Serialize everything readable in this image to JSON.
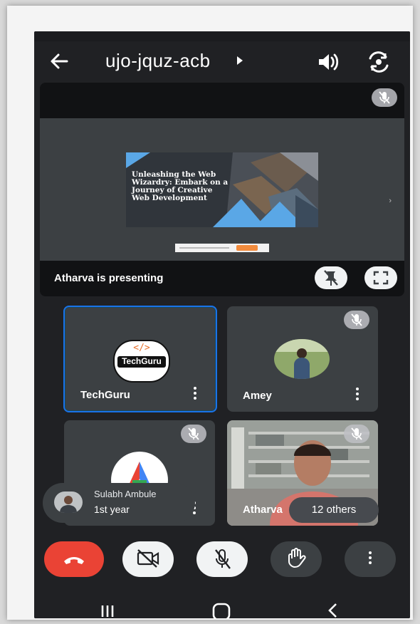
{
  "meeting": {
    "code": "ujo-jquz-acb"
  },
  "presentation": {
    "presenter_label": "Atharva is presenting",
    "slide_title": "Unleashing the Web Wizardry: Embark on a Journey of Creative Web Development"
  },
  "tiles": [
    {
      "name": "TechGuru",
      "logo_text": "TechGuru"
    },
    {
      "name": "Amey"
    },
    {
      "name": ""
    },
    {
      "name": "Atharva"
    }
  ],
  "self_view": {
    "name": "Sulabh Ambule",
    "subtitle": "1st year"
  },
  "others_label": "12 others",
  "colors": {
    "background": "#202124",
    "tile": "#3c4043",
    "end_call": "#ea4335",
    "active_border": "#1a73e8"
  },
  "icons": [
    "back-arrow-icon",
    "caret-right-icon",
    "speaker-icon",
    "switch-camera-icon",
    "mic-off-icon",
    "unpin-icon",
    "fullscreen-icon",
    "more-vert-icon",
    "end-call-icon",
    "camera-off-icon",
    "hand-raise-icon"
  ]
}
